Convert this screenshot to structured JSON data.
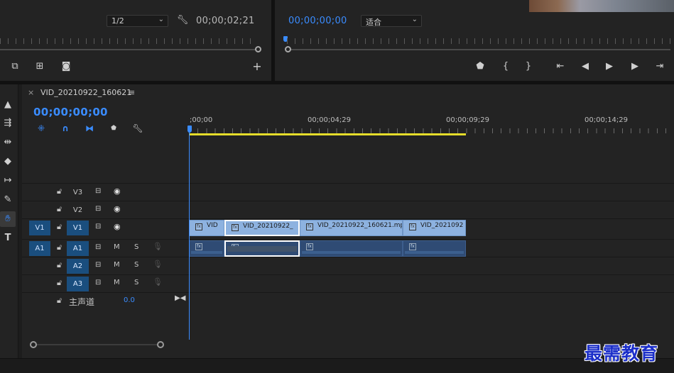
{
  "source_monitor": {
    "resolution": "1/2",
    "timecode": "00;00;02;21"
  },
  "program_monitor": {
    "timecode": "00;00;00;00",
    "fit": "适合"
  },
  "timeline": {
    "sequence_name": "VID_20210922_160621",
    "current_time": "00;00;00;00",
    "ruler_labels": [
      ";00;00",
      "00;00;04;29",
      "00;00;09;29",
      "00;00;14;29"
    ],
    "video_tracks": [
      {
        "name": "V3"
      },
      {
        "name": "V2"
      },
      {
        "name": "V1",
        "source": "V1"
      }
    ],
    "audio_tracks": [
      {
        "name": "A1",
        "source": "A1",
        "m": "M",
        "s": "S"
      },
      {
        "name": "A2",
        "m": "M",
        "s": "S"
      },
      {
        "name": "A3",
        "m": "M",
        "s": "S"
      }
    ],
    "master": {
      "label": "主声道",
      "value": "0.0"
    },
    "video_clips": [
      {
        "name": "VID"
      },
      {
        "name": "VID_20210922_"
      },
      {
        "name": "VID_20210922_160621.mp"
      },
      {
        "name": "VID_2021092"
      }
    ],
    "fx_badge": "fx"
  },
  "icons": {
    "wrench": "wrench-icon",
    "play": "play-icon",
    "marker": "marker-icon",
    "snap": "snap-magnet-icon"
  },
  "colors": {
    "accent": "#3a8cff",
    "work_area": "#e5dd2a",
    "video_clip": "#8db2e0",
    "audio_clip": "#2f4b74",
    "track_target": "#1a4e7e"
  },
  "watermark": "最需教育"
}
